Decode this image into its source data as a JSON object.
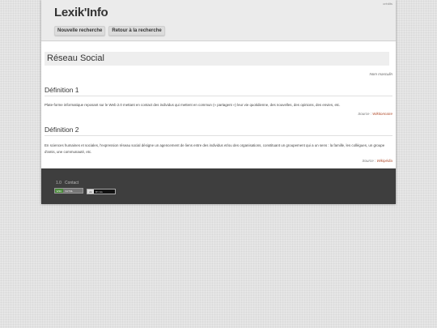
{
  "header": {
    "credits_link": "crédits",
    "logo": "Lexik'Info",
    "nav": {
      "new_search": "Nouvelle recherche",
      "back_to_search": "Retour à la recherche"
    }
  },
  "entry": {
    "title": "Réseau Social",
    "gender": "Nom masculin",
    "definitions": [
      {
        "heading": "Définition 1",
        "text": "Plate-forme informatique reposant sur le Web 2.0 mettant en contact des individus qui mettent en commun (« partagent ») leur vie quotidienne, des nouvelles, des opinions, des envies, etc.",
        "source_label": "Source :",
        "source_link": "Wiktionnaire"
      },
      {
        "heading": "Définition 2",
        "text": "En sciences humaines et sociales, l'expression réseau social désigne un agencement de liens entre des individus et/ou des organisations, constituant un groupement qui a un sens : la famille, les collègues, un groupe d'amis, une communauté, etc.",
        "source_label": "Source :",
        "source_link": "Wikipédia"
      }
    ]
  },
  "footer": {
    "version": "1.0",
    "contact": "Contact",
    "badge_valid": "W3C",
    "badge_valid_text": "XHTML",
    "badge_license": "cc",
    "badge_license_text": "BY-SA"
  }
}
